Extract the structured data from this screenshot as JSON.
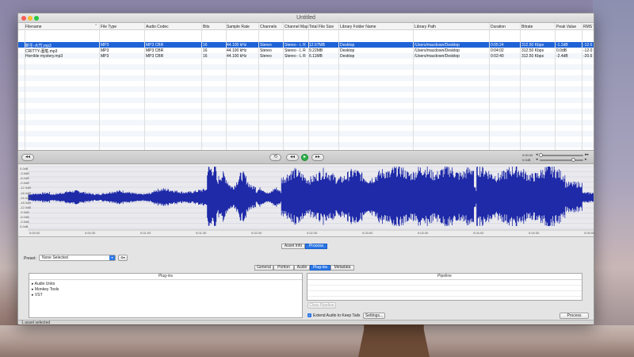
{
  "window": {
    "title": "Untitled"
  },
  "table": {
    "columns": [
      "Filename",
      "File Type",
      "Audio Codec",
      "Bits",
      "Sample Rate",
      "Channels",
      "Channel Map",
      "Total File Size",
      "Library Folder Name",
      "Library Path",
      "Duration",
      "Bitrate",
      "Peak Value",
      "RMS V"
    ],
    "rows": [
      [
        "新生-大竹.mp3",
        "MP3",
        "MP3 CBR",
        "16",
        "44.100 kHz",
        "Stereo",
        "Stereo - L R",
        "12.67MB",
        "Desktop",
        "/Users/macdown/Desktop",
        "0:05:24",
        "312.50 Kbps",
        "-1.2dB",
        "-12.6"
      ],
      [
        "CRITTY-酒笔.mp3",
        "MP3",
        "MP3 CBR",
        "16",
        "44.100 kHz",
        "Stereo",
        "Stereo - L R",
        "9.22MB",
        "Desktop",
        "/Users/macdown/Desktop",
        "0:04:02",
        "312.50 Kbps",
        "0.0dB",
        "-12.0"
      ],
      [
        "Horrible mystery.mp3",
        "MP3",
        "MP3 CBR",
        "16",
        "44.100 kHz",
        "Stereo",
        "Stereo - L R",
        "6.11MB",
        "Desktop",
        "/Users/macdown/Desktop",
        "0:02:40",
        "312.50 Kbps",
        "-2.4dB",
        "-20.6"
      ]
    ]
  },
  "transport": {
    "rewind_label": "◂◂",
    "loop_label": "⟲",
    "prev_label": "◂◂",
    "play_label": "▸",
    "next_label": "▸▸",
    "time_a": "0:00:00",
    "time_b": "0.0dB"
  },
  "waveform": {
    "color": "#1e2aa8",
    "db_labels": [
      "0.0dB",
      "-3.5dB",
      "-6.0dB",
      "-9.5dB",
      "-12.0dB",
      "-18.0dB",
      "-24.0dB",
      "-18.0dB",
      "-12.0dB",
      "-9.5dB",
      "-6.0dB",
      "-3.5dB",
      "0.0dB"
    ],
    "time_labels": [
      "0:00:00",
      "0:00:30",
      "0:01:00",
      "0:01:30",
      "0:02:00",
      "0:02:30",
      "0:03:00",
      "0:03:30",
      "0:04:00",
      "0:04:30",
      "0:05:00"
    ]
  },
  "inspector": {
    "tabs": [
      "Asset Info",
      "Process"
    ],
    "active_tab": "Process",
    "preset_label": "Preset:",
    "preset_value": "None Selected",
    "subtabs": [
      "General",
      "Portion",
      "Audio",
      "Plug-ins",
      "Metadata"
    ],
    "active_subtab": "Plug-ins",
    "plugins_header": "Plug-ins",
    "plugins": [
      "Audio Units",
      "Monkey Tools",
      "VST"
    ],
    "pipeline_header": "Pipeline",
    "clear_pipeline_label": "Clear Pipeline",
    "extend_audio_label": "Extend Audio to Keep Tails",
    "settings_label": "Settings...",
    "process_label": "Process"
  },
  "status": {
    "text": "1 asset selected"
  }
}
